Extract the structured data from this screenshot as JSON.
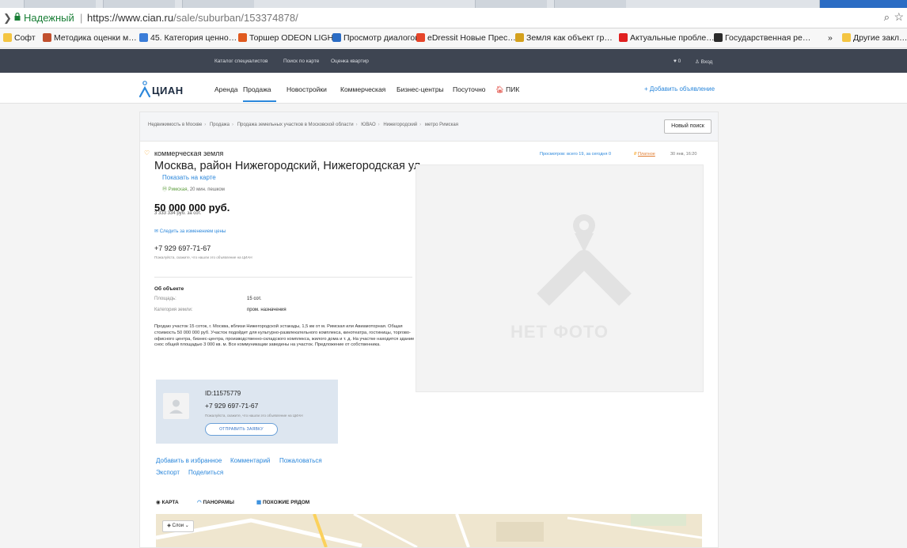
{
  "browser": {
    "secure_label": "Надежный",
    "url_host": "https://www.cian.ru",
    "url_path": "/sale/suburban/153374878/",
    "bookmarks": [
      {
        "label": "Софт",
        "color": "#f4c542"
      },
      {
        "label": "Методика оценки м…",
        "color": "#c1502e"
      },
      {
        "label": "45. Категория ценно…",
        "color": "#3b7dd8"
      },
      {
        "label": "Торшер ODEON LIGH…",
        "color": "#e05a1f"
      },
      {
        "label": "Просмотр диалогов",
        "color": "#2b6cc4"
      },
      {
        "label": "eDressit Новые Прес…",
        "color": "#e6452a"
      },
      {
        "label": "Земля как объект гр…",
        "color": "#d4a11e"
      },
      {
        "label": "Актуальные пробле…",
        "color": "#e02020"
      },
      {
        "label": "Государственная ре…",
        "color": "#2a2a2a"
      },
      {
        "label": "»",
        "color": ""
      },
      {
        "label": "Другие закл…",
        "color": "#f4c542"
      }
    ]
  },
  "topbar": {
    "links": [
      "Каталог специалистов",
      "Поиск по карте",
      "Оценка квартир"
    ],
    "favorites": "♥ 0",
    "login": "Вход"
  },
  "nav": {
    "logo": "ЦИАН",
    "items": [
      "Аренда",
      "Продажа",
      "Новостройки",
      "Коммерческая",
      "Бизнес-центры",
      "Посуточно",
      "ПИК"
    ],
    "add_listing": "+ Добавить объявление"
  },
  "breadcrumbs": [
    "Недвижимость в Москве",
    "Продажа",
    "Продажа земельных участков в Московской области",
    "ЮВАО",
    "Нижегородский",
    "метро Римская"
  ],
  "new_search": "Новый поиск",
  "listing": {
    "category": "коммерческая земля",
    "title": "Москва, район Нижегородский, Нижегородская ул.",
    "show_on_map": "Показать на карте",
    "metro_station": "Римская",
    "metro_time": ", 20 мин. пешком",
    "price": "50 000 000 руб.",
    "price_per": "3 333 334 руб. за сот.",
    "price_watch": "Следить за изменением цены",
    "phone": "+7 929 697-71-67",
    "phone_note": "Пожалуйста, скажите, что нашли это объявление на ЦИАН",
    "views": "Просмотров: всего 19, за сегодня 0",
    "paid": "Платное",
    "date": "30 янв, 16:20",
    "no_photo": "НЕТ ФОТО"
  },
  "about": {
    "heading": "Об объекте",
    "area_label": "Площадь:",
    "area_value": "15 сот.",
    "category_label": "Категория земли:",
    "category_value": "пром. назначения",
    "description": "Продаю участок 15 соток, г. Москва, вблизи Нижегородской эстакады, 1,5 км от м. Римская или Авиамоторная. Общая стоимость 50 000 000 руб. Участок подойдет для культурно-развлекательного комплекса, кинотеатра, гостиницы, торгово-офисного центра, бизнес-центра, производственно-складского комплекса, жилого дома и т. д. На участке находится здание под снос общей площадью 3 000 кв. м. Все коммуникации заведены на участок. Предложение от собственника."
  },
  "contact": {
    "id": "ID:11575779",
    "phone": "+7 929 697-71-67",
    "note": "Пожалуйста, скажите, что нашли это объявление на ЦИАН",
    "send_request": "ОТПРАВИТЬ ЗАЯВКУ"
  },
  "actions": {
    "favorite": "Добавить в избранное",
    "comment": "Комментарий",
    "complain": "Пожаловаться",
    "export": "Экспорт",
    "share": "Поделиться"
  },
  "map_tabs": {
    "map": "КАРТА",
    "panoramas": "ПАНОРАМЫ",
    "nearby": "ПОХОЖИЕ РЯДОМ",
    "layers": "Слои"
  }
}
